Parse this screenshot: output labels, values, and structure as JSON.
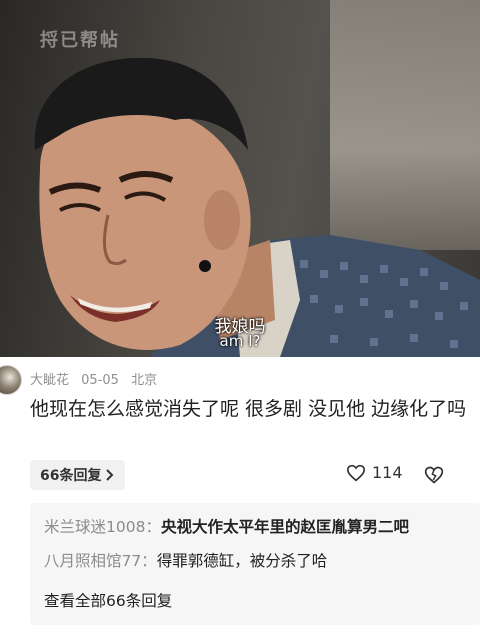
{
  "video": {
    "watermark": "捋已帮帖",
    "subtitle_cn": "我娘吗",
    "subtitle_en": "am I?"
  },
  "comment": {
    "username": "大眦花",
    "date": "05-05",
    "location": "北京",
    "text": "他现在怎么感觉消失了呢 很多剧 没见他 边缘化了吗",
    "reply_count_label": "66条回复",
    "like_count": "114"
  },
  "replies": [
    {
      "user": "米兰球迷1008：",
      "text": "央视大作太平年里的赵匡胤算男二吧"
    },
    {
      "user": "八月照相馆77：",
      "text": "得罪郭德缸，被分杀了哈"
    }
  ],
  "view_all_label": "查看全部66条回复",
  "colors": {
    "meta_gray": "#8f8f8f",
    "reply_box_bg": "#f6f6f6",
    "pill_bg": "#f1f1f1"
  },
  "icons": [
    "avatar",
    "chevron-right-icon",
    "heart-icon",
    "broken-heart-icon"
  ]
}
